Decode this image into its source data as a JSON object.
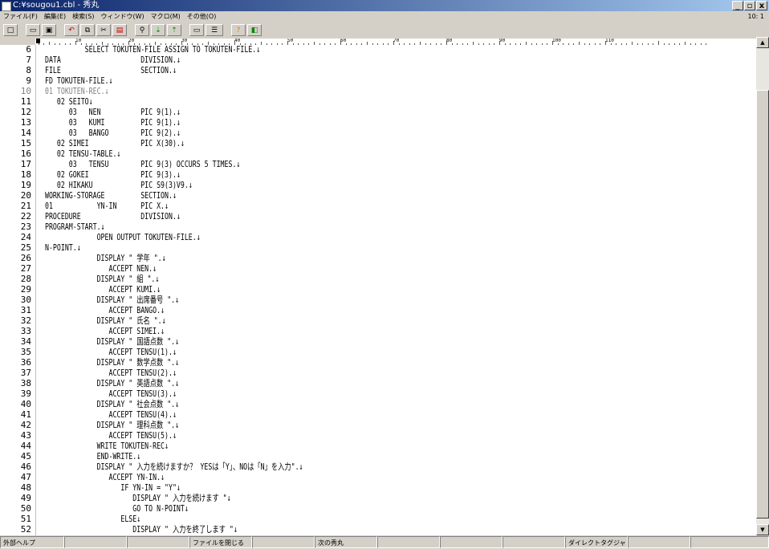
{
  "window": {
    "title": "C:¥sougou1.cbl - 秀丸",
    "min": "_",
    "max": "▫",
    "close": "x"
  },
  "menu": [
    "ファイル(F)",
    "編集(E)",
    "検索(S)",
    "ウィンドウ(W)",
    "マクロ(M)",
    "その他(O)"
  ],
  "cursor_pos": "10: 1",
  "ruler_labels": [
    "10",
    "20",
    "30",
    "40",
    "50",
    "60",
    "70",
    "80",
    "90",
    "100",
    "110"
  ],
  "lines": [
    {
      "n": "6",
      "t": "          SELECT TOKUTEN-FILE ASSIGN TO TOKUTEN-FILE.↓"
    },
    {
      "n": "7",
      "t": "DATA                    DIVISION.↓"
    },
    {
      "n": "8",
      "t": "FILE                    SECTION.↓"
    },
    {
      "n": "9",
      "t": "FD TOKUTEN-FILE.↓"
    },
    {
      "n": "10",
      "t": "01 TOKUTEN-REC.↓"
    },
    {
      "n": "11",
      "t": "   02 SEITO↓"
    },
    {
      "n": "12",
      "t": "      03   NEN          PIC 9(1).↓"
    },
    {
      "n": "13",
      "t": "      03   KUMI         PIC 9(1).↓"
    },
    {
      "n": "14",
      "t": "      03   BANGO        PIC 9(2).↓"
    },
    {
      "n": "15",
      "t": "   02 SIMEI             PIC X(30).↓"
    },
    {
      "n": "16",
      "t": "   02 TENSU-TABLE.↓"
    },
    {
      "n": "17",
      "t": "      03   TENSU        PIC 9(3) OCCURS 5 TIMES.↓"
    },
    {
      "n": "18",
      "t": "   02 GOKEI             PIC 9(3).↓"
    },
    {
      "n": "19",
      "t": "   02 HIKAKU            PIC S9(3)V9.↓"
    },
    {
      "n": "20",
      "t": "WORKING-STORAGE         SECTION.↓"
    },
    {
      "n": "21",
      "t": "01           YN-IN      PIC X.↓"
    },
    {
      "n": "22",
      "t": "PROCEDURE               DIVISION.↓"
    },
    {
      "n": "23",
      "t": "PROGRAM-START.↓"
    },
    {
      "n": "24",
      "t": "             OPEN OUTPUT TOKUTEN-FILE.↓"
    },
    {
      "n": "25",
      "t": "N-POINT.↓"
    },
    {
      "n": "26",
      "t": "             DISPLAY \" 学年 \".↓"
    },
    {
      "n": "27",
      "t": "                ACCEPT NEN.↓"
    },
    {
      "n": "28",
      "t": "             DISPLAY \" 組 \".↓"
    },
    {
      "n": "29",
      "t": "                ACCEPT KUMI.↓"
    },
    {
      "n": "30",
      "t": "             DISPLAY \" 出席番号 \".↓"
    },
    {
      "n": "31",
      "t": "                ACCEPT BANGO.↓"
    },
    {
      "n": "32",
      "t": "             DISPLAY \" 氏名 \".↓"
    },
    {
      "n": "33",
      "t": "                ACCEPT SIMEI.↓"
    },
    {
      "n": "34",
      "t": "             DISPLAY \" 国語点数 \".↓"
    },
    {
      "n": "35",
      "t": "                ACCEPT TENSU(1).↓"
    },
    {
      "n": "36",
      "t": "             DISPLAY \" 数学点数 \".↓"
    },
    {
      "n": "37",
      "t": "                ACCEPT TENSU(2).↓"
    },
    {
      "n": "38",
      "t": "             DISPLAY \" 英語点数 \".↓"
    },
    {
      "n": "39",
      "t": "                ACCEPT TENSU(3).↓"
    },
    {
      "n": "40",
      "t": "             DISPLAY \" 社会点数 \".↓"
    },
    {
      "n": "41",
      "t": "                ACCEPT TENSU(4).↓"
    },
    {
      "n": "42",
      "t": "             DISPLAY \" 理科点数 \".↓"
    },
    {
      "n": "43",
      "t": "                ACCEPT TENSU(5).↓"
    },
    {
      "n": "44",
      "t": "             WRITE TOKUTEN-REC↓"
    },
    {
      "n": "45",
      "t": "             END-WRITE.↓"
    },
    {
      "n": "46",
      "t": "             DISPLAY \" 入力を続けますか？ YESは「Y」、NOは「N」を入力\".↓"
    },
    {
      "n": "47",
      "t": "                ACCEPT YN-IN.↓"
    },
    {
      "n": "48",
      "t": "                   IF YN-IN = \"Y\"↓"
    },
    {
      "n": "49",
      "t": "                      DISPLAY \" 入力を続けます \"↓"
    },
    {
      "n": "50",
      "t": "                      GO TO N-POINT↓"
    },
    {
      "n": "51",
      "t": "                   ELSE↓"
    },
    {
      "n": "52",
      "t": "                      DISPLAY \" 入力を終了します \"↓"
    }
  ],
  "status": [
    "外部ヘルプ",
    "",
    "",
    "ファイルを閉じる",
    "",
    "次の秀丸",
    "",
    "",
    "",
    "ダイレクトタグジャンプ",
    "",
    ""
  ]
}
